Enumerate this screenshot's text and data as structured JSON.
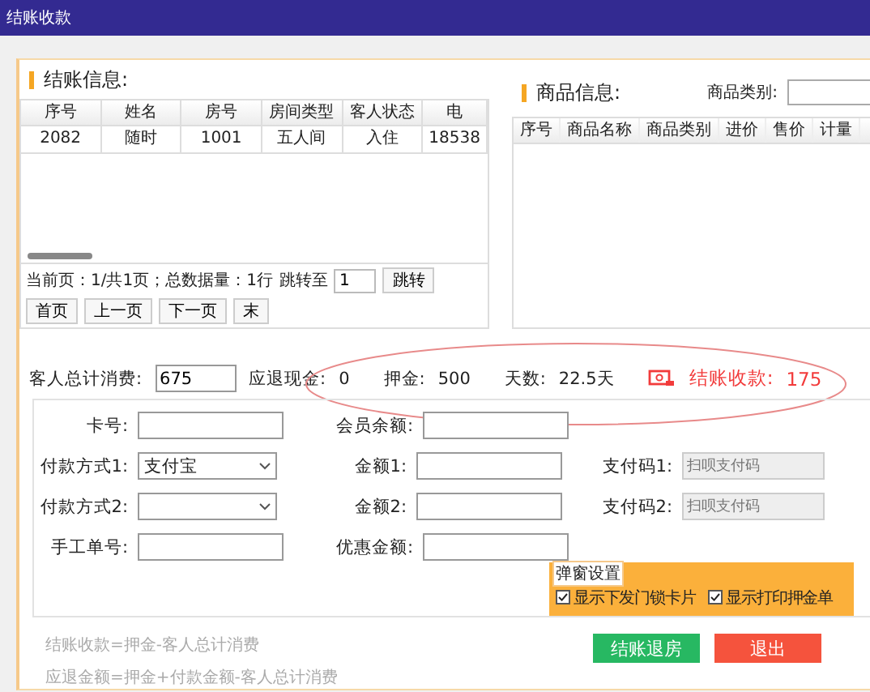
{
  "window": {
    "title": "结账收款"
  },
  "checkout_info": {
    "title": "结账信息:",
    "columns": [
      "序号",
      "姓名",
      "房号",
      "房间类型",
      "客人状态",
      "电"
    ],
    "rows": [
      [
        "2082",
        "随时",
        "1001",
        "五人间",
        "入住",
        "18538"
      ]
    ],
    "pagination": {
      "status": "当前页：1/共1页；总数据量：1行",
      "jump_label": "跳转至",
      "page_input": "1",
      "buttons": [
        "跳转",
        "首页",
        "上一页",
        "下一页",
        "末"
      ]
    }
  },
  "goods_info": {
    "title": "商品信息:",
    "category_label": "商品类别:",
    "columns": [
      "序号",
      "商品名称",
      "商品类别",
      "进价",
      "售价",
      "计量"
    ]
  },
  "summary": {
    "total_consumption_label": "客人总计消费:",
    "total_consumption": "675",
    "refund_label": "应退现金:",
    "refund": "0",
    "deposit_label": "押金:",
    "deposit": "500",
    "days_label": "天数:",
    "days": "22.5天",
    "collect_label": "结账收款:",
    "collect": "175"
  },
  "form": {
    "rows": [
      [
        {
          "kind": "input",
          "label": "卡号:",
          "disabled": false
        },
        {
          "kind": "input",
          "label": "会员余额:",
          "disabled": false
        }
      ],
      [
        {
          "kind": "select",
          "label": "付款方式1:",
          "value": "支付宝"
        },
        {
          "kind": "input",
          "label": "金额1:",
          "disabled": false
        },
        {
          "kind": "input",
          "label": "支付码1:",
          "placeholder": "扫呗支付码",
          "disabled": true
        }
      ],
      [
        {
          "kind": "select",
          "label": "付款方式2:"
        },
        {
          "kind": "input",
          "label": "金额2:",
          "disabled": false
        },
        {
          "kind": "input",
          "label": "支付码2:",
          "placeholder": "扫呗支付码",
          "disabled": true
        }
      ],
      [
        {
          "kind": "input",
          "label": "手工单号:",
          "disabled": false
        },
        {
          "kind": "input",
          "label": "优惠金额:",
          "disabled": false
        }
      ]
    ]
  },
  "popup_settings": {
    "title": "弹窗设置",
    "options": [
      {
        "label": "显示下发门锁卡片",
        "checked": true
      },
      {
        "label": "显示打印押金单",
        "checked": true
      }
    ]
  },
  "formulas": [
    "结账收款=押金-客人总计消费",
    "应退金额=押金+付款金额-客人总计消费"
  ],
  "buttons": [
    {
      "kind": "primary",
      "label": "结账退房"
    },
    {
      "kind": "danger",
      "label": "退出"
    }
  ]
}
